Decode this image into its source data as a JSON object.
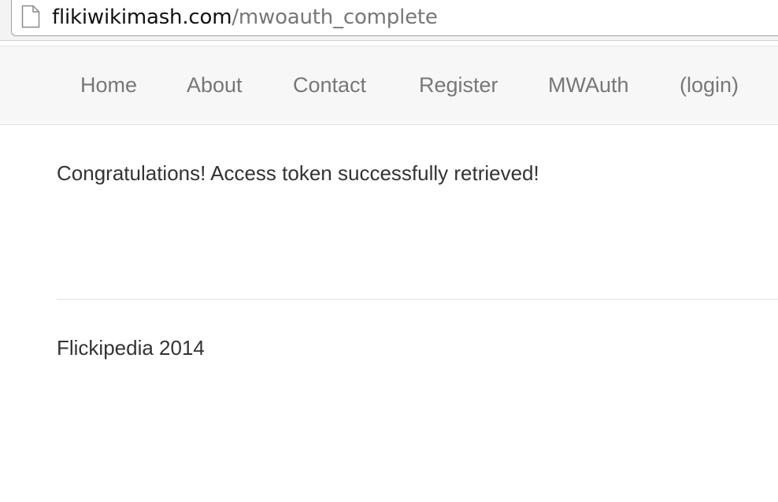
{
  "browser": {
    "url_domain": "flikiwikimash.com",
    "url_path": "/mwoauth_complete",
    "page_icon": "document-icon"
  },
  "nav": {
    "items": [
      {
        "label": "Home"
      },
      {
        "label": "About"
      },
      {
        "label": "Contact"
      },
      {
        "label": "Register"
      },
      {
        "label": "MWAuth"
      },
      {
        "label": "(login)"
      }
    ]
  },
  "main": {
    "message": "Congratulations! Access token successfully retrieved!"
  },
  "footer": {
    "text": "Flickipedia 2014"
  },
  "colors": {
    "nav_text": "#777777",
    "body_text": "#333333",
    "navbar_bg": "#f7f7f7"
  }
}
